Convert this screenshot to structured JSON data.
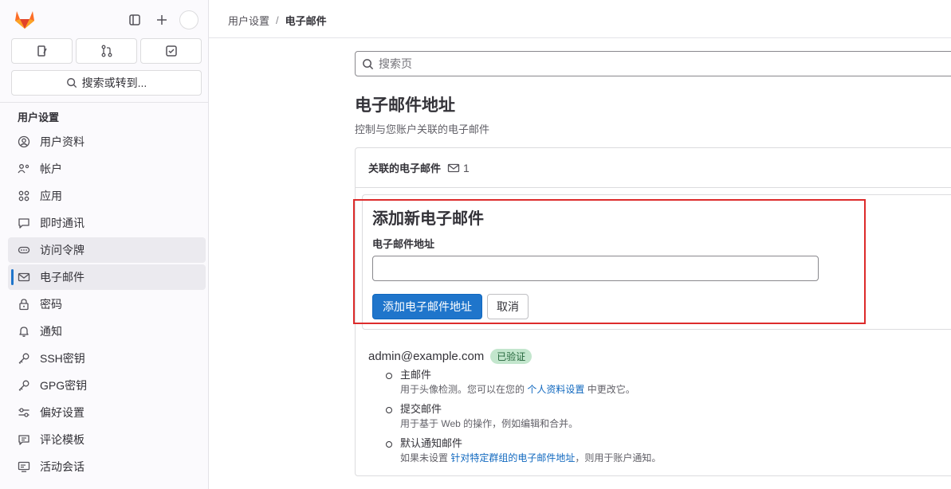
{
  "sidebar": {
    "search_label": "搜索或转到...",
    "section_title": "用户设置",
    "items": [
      {
        "label": "用户资料",
        "icon": "profile-icon"
      },
      {
        "label": "帐户",
        "icon": "account-icon"
      },
      {
        "label": "应用",
        "icon": "applications-icon"
      },
      {
        "label": "即时通讯",
        "icon": "chat-icon"
      },
      {
        "label": "访问令牌",
        "icon": "token-icon"
      },
      {
        "label": "电子邮件",
        "icon": "mail-icon"
      },
      {
        "label": "密码",
        "icon": "lock-icon"
      },
      {
        "label": "通知",
        "icon": "bell-icon"
      },
      {
        "label": "SSH密钥",
        "icon": "key-icon"
      },
      {
        "label": "GPG密钥",
        "icon": "key-icon"
      },
      {
        "label": "偏好设置",
        "icon": "preferences-icon"
      },
      {
        "label": "评论模板",
        "icon": "comment-icon"
      },
      {
        "label": "活动会话",
        "icon": "monitor-icon"
      }
    ]
  },
  "breadcrumb": {
    "parent": "用户设置",
    "sep": "/",
    "current": "电子邮件"
  },
  "page": {
    "search_placeholder": "搜索页",
    "title": "电子邮件地址",
    "subtitle": "控制与您账户关联的电子邮件"
  },
  "card": {
    "header": "关联的电子邮件",
    "count": "1"
  },
  "form": {
    "title": "添加新电子邮件",
    "label": "电子邮件地址",
    "value": "",
    "submit": "添加电子邮件地址",
    "cancel": "取消"
  },
  "email": {
    "address": "admin@example.com",
    "badge": "已验证",
    "items": [
      {
        "title": "主邮件",
        "desc_before": "用于头像检测。您可以在您的 ",
        "link": "个人资料设置",
        "desc_after": " 中更改它。"
      },
      {
        "title": "提交邮件",
        "desc_before": "用于基于 Web 的操作，例如编辑和合并。",
        "link": "",
        "desc_after": ""
      },
      {
        "title": "默认通知邮件",
        "desc_before": "如果未设置 ",
        "link": "针对特定群组的电子邮件地址",
        "desc_after": "，则用于账户通知。"
      }
    ]
  },
  "colors": {
    "accent": "#1f75cb",
    "badge_bg": "#c3e6cd",
    "highlight": "#dd2b2b"
  }
}
